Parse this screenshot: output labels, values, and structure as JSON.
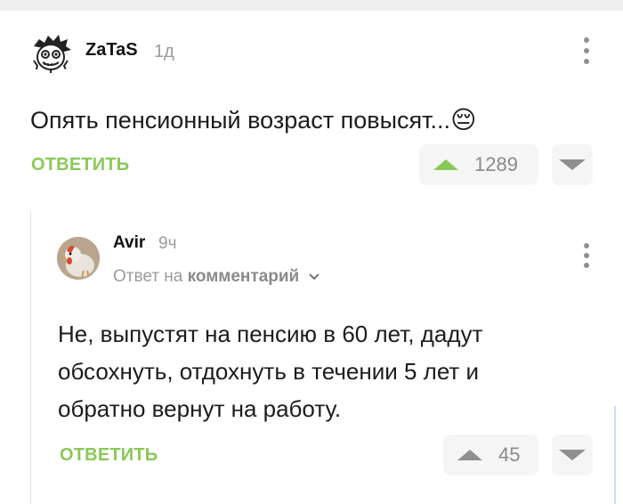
{
  "comment1": {
    "author": "ZaTaS",
    "time": "1д",
    "text": "Опять пенсионный возраст повысят...",
    "emoji": "😔",
    "reply_label": "ОТВЕТИТЬ",
    "rating": "1289"
  },
  "comment2": {
    "author": "Avir",
    "time": "9ч",
    "reply_to_prefix": "Ответ на",
    "reply_to_link": "комментарий",
    "text_line1": "Не, выпустят на пенсию в 60 лет, дадут",
    "text_line2": "обсохнуть, отдохнуть в течении 5 лет и",
    "text_line3": "обратно вернут на работу.",
    "reply_label": "ОТВЕТИТЬ",
    "rating": "45"
  },
  "colors": {
    "accent_green": "#8ac858",
    "upvote_green": "#8ac858",
    "icon_grey": "#8f8f8f",
    "vote_bg": "#f5f5f5"
  },
  "icons": [
    "more-vertical-icon",
    "upvote-icon",
    "downvote-icon",
    "chevron-down-icon",
    "sad-face-emoji"
  ]
}
